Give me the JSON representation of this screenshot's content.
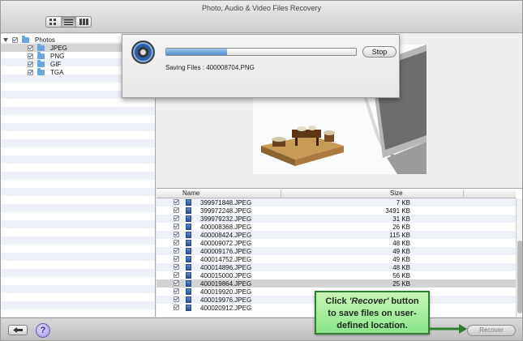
{
  "window": {
    "title": "Photo, Audio & Video Files Recovery"
  },
  "toolbar": {
    "view_modes": [
      "icon-view-icon",
      "list-view-icon",
      "column-view-icon"
    ],
    "active_view": 1
  },
  "tree": {
    "root": {
      "label": "Photos"
    },
    "children": [
      {
        "label": "JPEG",
        "selected": true
      },
      {
        "label": "PNG"
      },
      {
        "label": "GIF"
      },
      {
        "label": "TGA"
      }
    ]
  },
  "progress": {
    "fraction": 0.32,
    "stop_label": "Stop",
    "status_text": "Saving Files : 400008704.PNG"
  },
  "table": {
    "columns": {
      "name": "Name",
      "size": "Size"
    },
    "rows": [
      {
        "name": "399971848.JPEG",
        "size": "7 KB"
      },
      {
        "name": "399972248.JPEG",
        "size": "3491 KB"
      },
      {
        "name": "399979232.JPEG",
        "size": "31 KB"
      },
      {
        "name": "400008368.JPEG",
        "size": "26 KB"
      },
      {
        "name": "400008424.JPEG",
        "size": "115 KB"
      },
      {
        "name": "400009072.JPEG",
        "size": "48 KB"
      },
      {
        "name": "400009176.JPEG",
        "size": "49 KB"
      },
      {
        "name": "400014752.JPEG",
        "size": "49 KB"
      },
      {
        "name": "400014896.JPEG",
        "size": "48 KB"
      },
      {
        "name": "400015000.JPEG",
        "size": "56 KB"
      },
      {
        "name": "400019864.JPEG",
        "size": "25 KB",
        "selected": true
      },
      {
        "name": "400019920.JPEG",
        "size": ""
      },
      {
        "name": "400019976.JPEG",
        "size": ""
      },
      {
        "name": "400020912.JPEG",
        "size": ""
      }
    ]
  },
  "bottom": {
    "recover_label": "Recover",
    "help_label": "?"
  },
  "callout": {
    "line1_prefix": "Click ",
    "line1_em": "'Recover'",
    "line1_suffix": " button",
    "line2": "to save files on user-",
    "line3": "defined location."
  },
  "colors": {
    "callout_bg": "#9be88f",
    "callout_border": "#2f7d2f",
    "progress_fill": "#4f8bd0",
    "row_alt": "#eef2f8"
  }
}
